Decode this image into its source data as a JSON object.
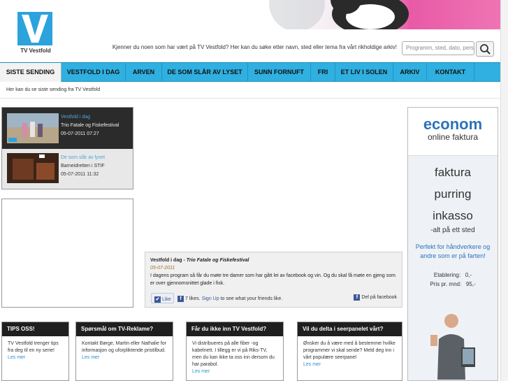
{
  "brand": {
    "logo_text": "TV Vestfold"
  },
  "header": {
    "tagline": "Kjenner du noen som har vært på TV Vestfold? Her kan du søke etter navn, sted eller tema fra vårt rikholdige arkiv!",
    "search_placeholder": "Programm, sted, dato, person"
  },
  "nav": [
    {
      "label": "SISTE SENDING",
      "active": true
    },
    {
      "label": "VESTFOLD I DAG"
    },
    {
      "label": "ARVEN"
    },
    {
      "label": "DE SOM SLÅR AV LYSET"
    },
    {
      "label": "SUNN FORNUFT"
    },
    {
      "label": "FRI"
    },
    {
      "label": "ET LIV I SOLEN"
    },
    {
      "label": "ARKIV"
    },
    {
      "label": "KONTAKT"
    }
  ],
  "page": {
    "subtitle": "Her kan du se siste sending fra TV Vestfold"
  },
  "recent": [
    {
      "category": "Vestfold i dag",
      "title": "Trio Fatale og Fiskefestival",
      "date": "05-07-2011 07:27"
    },
    {
      "category": "De som slår av lyset",
      "title": "Barneidretten i STIF",
      "date": "05-07-2011 11:32"
    }
  ],
  "feature": {
    "show": "Vestfold i dag - ",
    "title": "Trio Fatale og Fiskefestival",
    "date": "05-07-2011",
    "description": "I dagens program så får du møte tre damer som har gått lei av facebook og vin. Og du skal få møte en gjeng som er over gjennomsnittet glade i fisk.",
    "like_label": "Like",
    "likes_count": "7 likes.",
    "signup_link": "Sign Up",
    "signup_rest": " to see what your friends like.",
    "share_label": "Del på facebook"
  },
  "ad": {
    "brand": "econom",
    "brand_sub": "online faktura",
    "words": [
      "faktura",
      "purring",
      "inkasso"
    ],
    "tagline": "-alt på ett sted",
    "pitch": "Perfekt for håndverkere og andre som er på farten!",
    "price_rows": [
      {
        "label": "Etablering:",
        "value": "0,-"
      },
      {
        "label": "Pris pr. mnd:",
        "value": "95,-"
      }
    ]
  },
  "tips": [
    {
      "title": "TIPS OSS!",
      "text": "TV Vestfold trenger tips fra deg til en ny serie!",
      "more": "Les mer"
    },
    {
      "title": "Spørsmål om TV-Reklame?",
      "text": "Kontakt Børge, Martin eller Nathalie for informasjon og uforpliktende pristilbud.",
      "more": "Les mer"
    },
    {
      "title": "Får du ikke inn TV Vestfold?",
      "text": "Vi distribueres på alle fiber -og kabelnett. I tillegg er vi på Riks-TV, men du kan ikke ta oss inn dersom du har parabol.",
      "more": "Les mer"
    },
    {
      "title": "Vil du delta i seerpanelet vårt?",
      "text": "Ønsker du å være med å bestemme hvilke programmer vi skal sende? Meld deg inn i vårt populære seerpanel",
      "more": "Les mer"
    }
  ],
  "colors": {
    "accent": "#2fb0e0",
    "pink": "#e85aa6",
    "dark": "#1f1f1f",
    "fb": "#3b5998"
  }
}
